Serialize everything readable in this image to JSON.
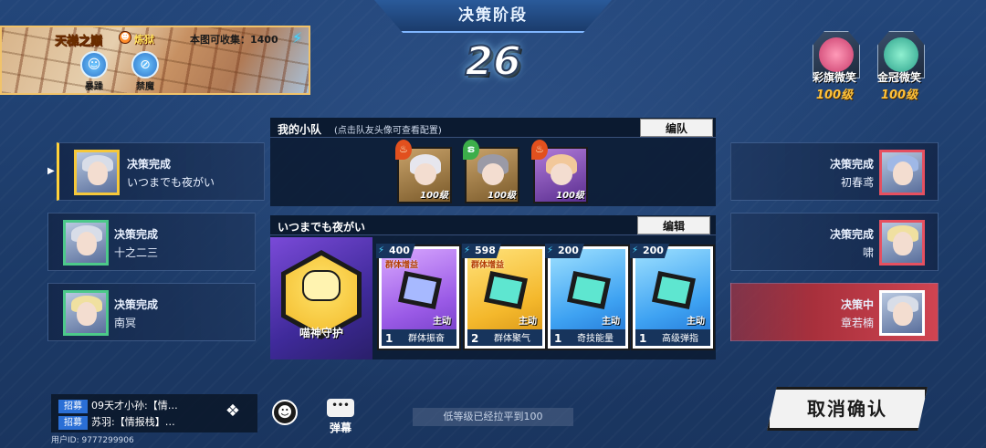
{
  "phase": {
    "title": "决策阶段",
    "timer": "26"
  },
  "map": {
    "name": "天梯之巅",
    "difficulty": "炼狱",
    "collect_text": "本图可收集：1400",
    "modifiers": [
      {
        "label": "暴躁"
      },
      {
        "label": "禁魔"
      }
    ]
  },
  "bosses": [
    {
      "name": "彩旗微笑",
      "level": "100级"
    },
    {
      "name": "金冠微笑",
      "level": "100级"
    }
  ],
  "players_left": [
    {
      "status": "决策完成",
      "name": "いつまでも夜がい"
    },
    {
      "status": "决策完成",
      "name": "十之二三"
    },
    {
      "status": "决策完成",
      "name": "南冥"
    }
  ],
  "players_right": [
    {
      "status": "决策完成",
      "name": "初春鸢"
    },
    {
      "status": "决策完成",
      "name": "啸"
    },
    {
      "status": "决策中",
      "name": "章若楠"
    }
  ],
  "squad": {
    "title": "我的小队",
    "hint": "(点击队友头像可查看配置)",
    "button": "编队",
    "members": [
      {
        "level": "100级"
      },
      {
        "level": "100级"
      },
      {
        "level": "100级"
      }
    ]
  },
  "deck": {
    "title": "いつまでも夜がい",
    "button": "编辑",
    "passive": "喵神守护",
    "cards": [
      {
        "cost": "400",
        "tag": "群体增益",
        "type": "主动",
        "count": "1",
        "name": "群体振奋"
      },
      {
        "cost": "598",
        "tag": "群体增益",
        "type": "主动",
        "count": "2",
        "name": "群体聚气"
      },
      {
        "cost": "200",
        "tag": "",
        "type": "主动",
        "count": "1",
        "name": "奇技能量"
      },
      {
        "cost": "200",
        "tag": "",
        "type": "主动",
        "count": "1",
        "name": "高级弹指"
      }
    ]
  },
  "chat": {
    "tag": "招募",
    "lines": [
      "09天才小孙:【情…",
      "苏羽:【情报栈】…"
    ],
    "uid": "用户ID: 9777299906"
  },
  "danmu": "弹幕",
  "notice": "低等级已经拉平到100",
  "cancel_button": "取消确认",
  "colors": {
    "accent_blue": "#45d7ff",
    "deciding_red": "#d04451",
    "gold": "#ffc23a"
  }
}
